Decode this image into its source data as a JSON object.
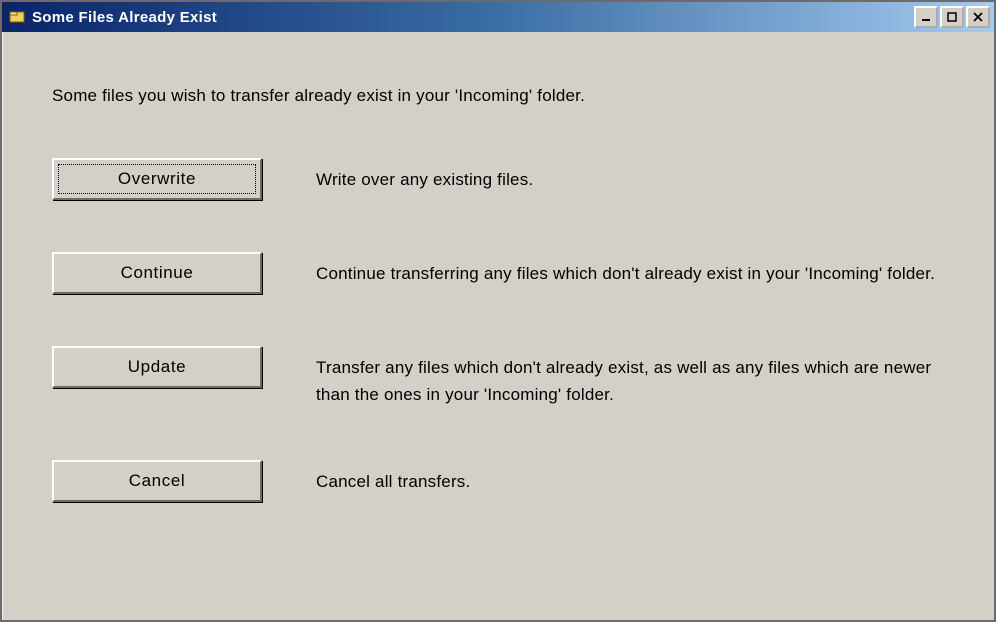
{
  "window": {
    "title": "Some Files Already Exist"
  },
  "intro": "Some files you wish to transfer already exist in your 'Incoming' folder.",
  "actions": {
    "overwrite": {
      "label": "Overwrite",
      "desc": "Write over any existing files."
    },
    "continue": {
      "label": "Continue",
      "desc": "Continue transferring any files which don't already exist in your 'Incoming' folder."
    },
    "update": {
      "label": "Update",
      "desc": "Transfer any files which don't already exist, as well as any files which are newer than the ones in your 'Incoming' folder."
    },
    "cancel": {
      "label": "Cancel",
      "desc": "Cancel all transfers."
    }
  }
}
